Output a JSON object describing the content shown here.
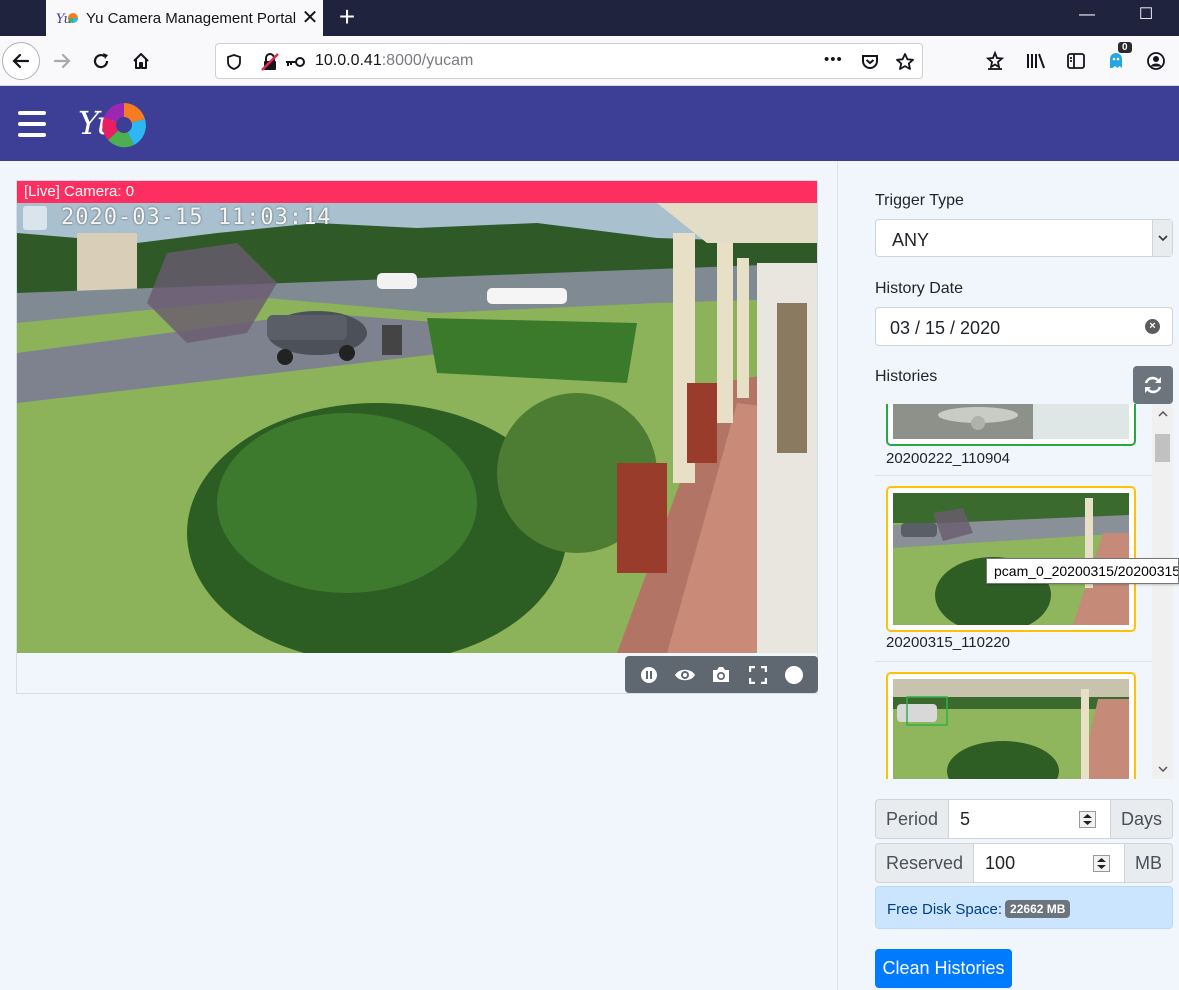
{
  "browser": {
    "tab_title": "Yu Camera Management Portal",
    "tab_close": "✕",
    "new_tab": "+",
    "url_host": "10.0.0.41",
    "url_rest": ":8000/yucam",
    "url_more": "•••",
    "extension_badge": "0",
    "window_minimize": "—",
    "window_maximize": "☐"
  },
  "camera": {
    "label": "[Live] Camera: 0",
    "timestamp": "2020-03-15 11:03:14",
    "controls": [
      "pause-icon",
      "eye-icon",
      "camera-icon",
      "fullscreen-icon",
      "record-icon"
    ]
  },
  "sidebar": {
    "trigger_type_label": "Trigger Type",
    "trigger_type_value": "ANY",
    "history_date_label": "History Date",
    "history_date_value": "03 / 15 / 2020",
    "histories_label": "Histories",
    "histories": [
      {
        "name": "20200222_110904",
        "border": "#28a745"
      },
      {
        "name": "20200315_110220",
        "border": "#ffc107"
      },
      {
        "name": "",
        "border": "#ffc107"
      }
    ],
    "tooltip": "pcam_0_20200315/20200315",
    "period_label": "Period",
    "period_value": "5",
    "period_unit": "Days",
    "reserved_label": "Reserved",
    "reserved_value": "100",
    "reserved_unit": "MB",
    "free_disk_label": "Free Disk Space:",
    "free_disk_value": "22662 MB",
    "clean_button": "Clean Histories"
  },
  "colors": {
    "header": "#3c3f95",
    "live_label": "#fd2f61",
    "primary": "#007bff",
    "thumb_border_event": "#ffc107",
    "thumb_border_motion": "#28a745"
  }
}
